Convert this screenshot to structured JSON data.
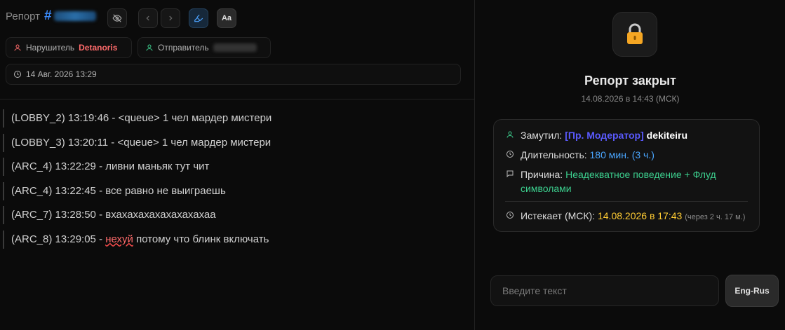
{
  "header": {
    "title": "Репорт",
    "hash": "#",
    "font_button_label": "Aa"
  },
  "chips": {
    "violator_label": "Нарушитель",
    "violator_name": "Detanoris",
    "sender_label": "Отправитель",
    "timestamp": "14 Авг. 2026 13:29"
  },
  "messages": [
    {
      "text": "(LOBBY_2) 13:19:46 - <queue> 1 чел мардер мистери"
    },
    {
      "text": "(LOBBY_3) 13:20:11 - <queue> 1 чел мардер мистери"
    },
    {
      "text": "(ARC_4) 13:22:29 - ливни маньяк тут чит"
    },
    {
      "text": "(ARC_4) 13:22:45 - все равно не выиграешь"
    },
    {
      "text": "(ARC_7) 13:28:50 - вхахахахахахахахахаа"
    },
    {
      "prefix": "(ARC_8) 13:29:05 - ",
      "flagged": "нехуй",
      "suffix": " потому что блинк включать"
    }
  ],
  "status": {
    "title": "Репорт закрыт",
    "closed_at": "14.08.2026 в 14:43 (МСК)"
  },
  "punishment": {
    "muted_by_label": "Замутил:",
    "moderator_role": "[Пр. Модератор]",
    "moderator_name": "dekiteiru",
    "duration_label": "Длительность:",
    "duration_value": "180 мин. (3 ч.)",
    "reason_label": "Причина:",
    "reason_value": "Неадекватное поведение + Флуд символами",
    "expires_label": "Истекает (МСК):",
    "expires_value": "14.08.2026 в 17:43",
    "expires_relative": "(через 2 ч. 17 м.)"
  },
  "composer": {
    "placeholder": "Введите текст",
    "layout_button": "Eng-Rus"
  },
  "colors": {
    "accent_blue": "#3b8cff",
    "violator_red": "#ff6b6b",
    "reason_green": "#3ccf8e",
    "expires_yellow": "#ffcc33",
    "moderator_role": "#5a5aff"
  },
  "icons": [
    "eye-off-icon",
    "chevron-left-icon",
    "chevron-right-icon",
    "highlighter-icon",
    "user-icon",
    "clock-icon",
    "lock-icon",
    "message-icon"
  ]
}
